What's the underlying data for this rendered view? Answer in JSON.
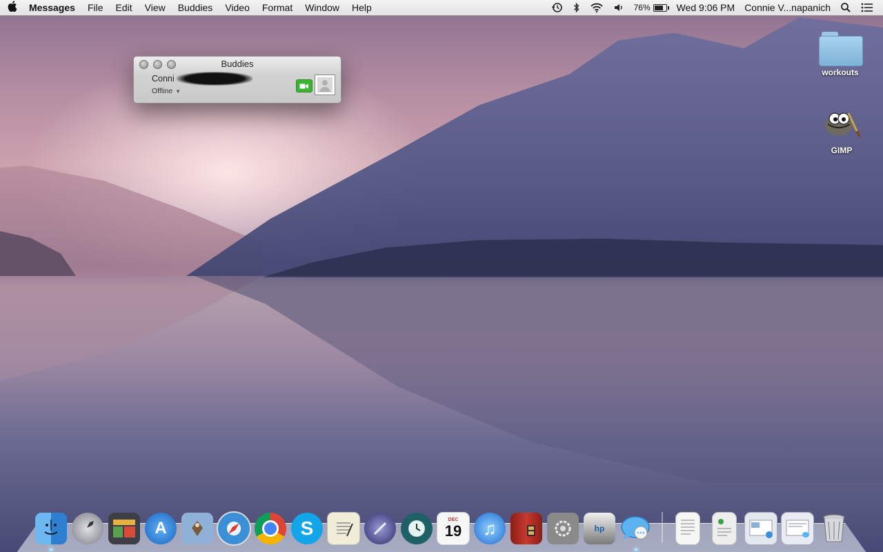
{
  "menubar": {
    "apple_icon": "apple-logo",
    "app_name": "Messages",
    "menus": [
      "File",
      "Edit",
      "View",
      "Buddies",
      "Video",
      "Format",
      "Window",
      "Help"
    ],
    "battery_percent": "76%",
    "battery_level": 0.76,
    "clock": "Wed 9:06 PM",
    "user_name": "Connie V...napanich",
    "status_icons": [
      "time-machine-icon",
      "bluetooth-icon",
      "wifi-icon",
      "volume-icon",
      "battery-icon",
      "spotlight-icon",
      "notification-center-icon"
    ]
  },
  "buddies_window": {
    "title": "Buddies",
    "buddy_name": "Conni",
    "status": "Offline"
  },
  "desktop_icons": [
    {
      "label": "workouts",
      "icon": "folder-icon"
    },
    {
      "label": "GIMP",
      "icon": "gimp-icon"
    }
  ],
  "dock": {
    "apps": [
      {
        "id": "finder",
        "icon": "finder-icon",
        "color": "#5aa3e8",
        "running": true
      },
      {
        "id": "launchpad",
        "icon": "launchpad-icon",
        "color": "#9a9aa4",
        "running": false
      },
      {
        "id": "dashboard",
        "icon": "dashboard-icon",
        "color": "#4a4a52",
        "running": false
      },
      {
        "id": "app-store",
        "icon": "app-store-icon",
        "color": "#2f86e0",
        "running": false
      },
      {
        "id": "mail",
        "icon": "mail-icon",
        "color": "#7aa3cf",
        "running": false
      },
      {
        "id": "safari",
        "icon": "safari-icon",
        "color": "#3a8fd6",
        "running": false
      },
      {
        "id": "chrome",
        "icon": "chrome-icon",
        "color": "#db4437",
        "running": false
      },
      {
        "id": "skype",
        "icon": "skype-icon",
        "color": "#12a5e8",
        "running": false
      },
      {
        "id": "textedit",
        "icon": "textedit-icon",
        "color": "#e9e2c8",
        "running": false
      },
      {
        "id": "script-editor",
        "icon": "script-editor-icon",
        "color": "#4a4a8a",
        "running": false
      },
      {
        "id": "time-machine",
        "icon": "time-machine-icon",
        "color": "#2c6d74",
        "running": false
      },
      {
        "id": "ical",
        "icon": "calendar-icon",
        "color": "#f2f2f2",
        "month": "DEC",
        "day": "19",
        "running": false
      },
      {
        "id": "itunes",
        "icon": "itunes-icon",
        "color": "#3b8de0",
        "running": false
      },
      {
        "id": "photo-booth",
        "icon": "photo-booth-icon",
        "color": "#a52a22",
        "running": false
      },
      {
        "id": "system-preferences",
        "icon": "system-preferences-icon",
        "color": "#8a8a8a",
        "running": false
      },
      {
        "id": "hp-utility",
        "icon": "hp-printer-icon",
        "color": "#6a6a6a",
        "running": false
      },
      {
        "id": "messages",
        "icon": "messages-icon",
        "color": "#5ab3f0",
        "running": true
      }
    ],
    "docs": [
      {
        "id": "doc-1",
        "icon": "document-stack-icon",
        "color": "#f4f4f4"
      },
      {
        "id": "doc-2",
        "icon": "document-stack-icon",
        "color": "#eaeaea"
      },
      {
        "id": "downloads",
        "icon": "downloads-stack-icon",
        "color": "#dfe3ea"
      },
      {
        "id": "screenshots",
        "icon": "screenshot-stack-icon",
        "color": "#e5e8ef"
      },
      {
        "id": "trash",
        "icon": "trash-icon",
        "color": "#b8bcc4"
      }
    ]
  }
}
